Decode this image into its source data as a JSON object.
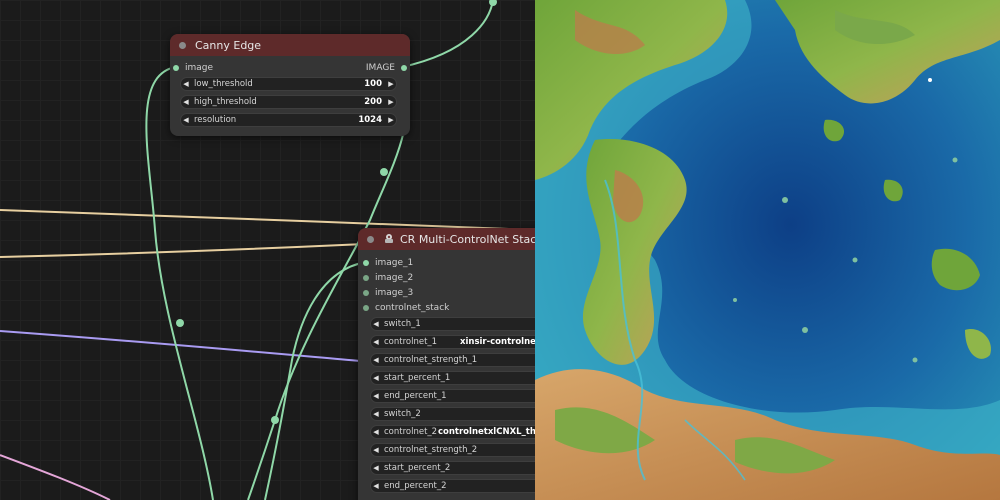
{
  "colors": {
    "link_green": "#8fd8a8",
    "link_tan": "#e7cfa0",
    "link_purple": "#a99bf2",
    "link_pink": "#e4a6d8",
    "node_header": "#5e2a2a",
    "node_body": "#353535"
  },
  "canny_node": {
    "title": "Canny Edge",
    "input_label": "image",
    "output_label": "IMAGE",
    "widgets": [
      {
        "label": "low_threshold",
        "value": "100"
      },
      {
        "label": "high_threshold",
        "value": "200"
      },
      {
        "label": "resolution",
        "value": "1024"
      }
    ]
  },
  "stack_node": {
    "title": "CR Multi-ControlNet Stack",
    "icon": "puzzle-icon",
    "inputs": [
      "image_1",
      "image_2",
      "image_3",
      "controlnet_stack"
    ],
    "widgets": [
      {
        "label": "switch_1",
        "value": ""
      },
      {
        "label": "controlnet_1",
        "value": "xinsir-controlne"
      },
      {
        "label": "controlnet_strength_1",
        "value": ""
      },
      {
        "label": "start_percent_1",
        "value": ""
      },
      {
        "label": "end_percent_1",
        "value": ""
      },
      {
        "label": "switch_2",
        "value": ""
      },
      {
        "label": "controlnet_2",
        "value": "controlnetxlCNXL_themis"
      },
      {
        "label": "controlnet_strength_2",
        "value": ""
      },
      {
        "label": "start_percent_2",
        "value": ""
      },
      {
        "label": "end_percent_2",
        "value": ""
      }
    ]
  },
  "map_image": {
    "icon": "fantasy-map-image"
  }
}
